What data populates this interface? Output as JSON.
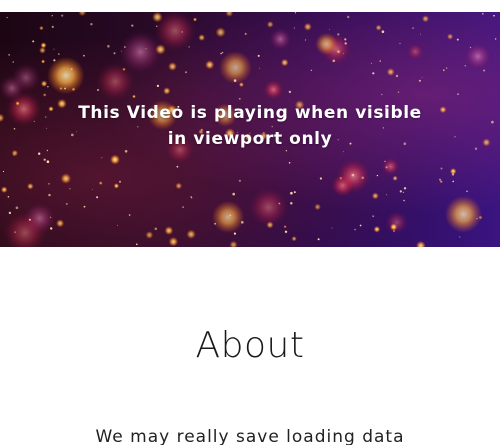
{
  "hero": {
    "caption_line1": "This Video is playing when visible",
    "caption_line2": "in viewport only"
  },
  "about": {
    "title": "About",
    "text": "We may really save loading data"
  },
  "colors": {
    "background": "#ffffff",
    "hero_dark": "#1c0613",
    "hero_purple": "#3a1480",
    "particle_warm": "#ffb347",
    "text_dark": "#1a1a1a"
  }
}
